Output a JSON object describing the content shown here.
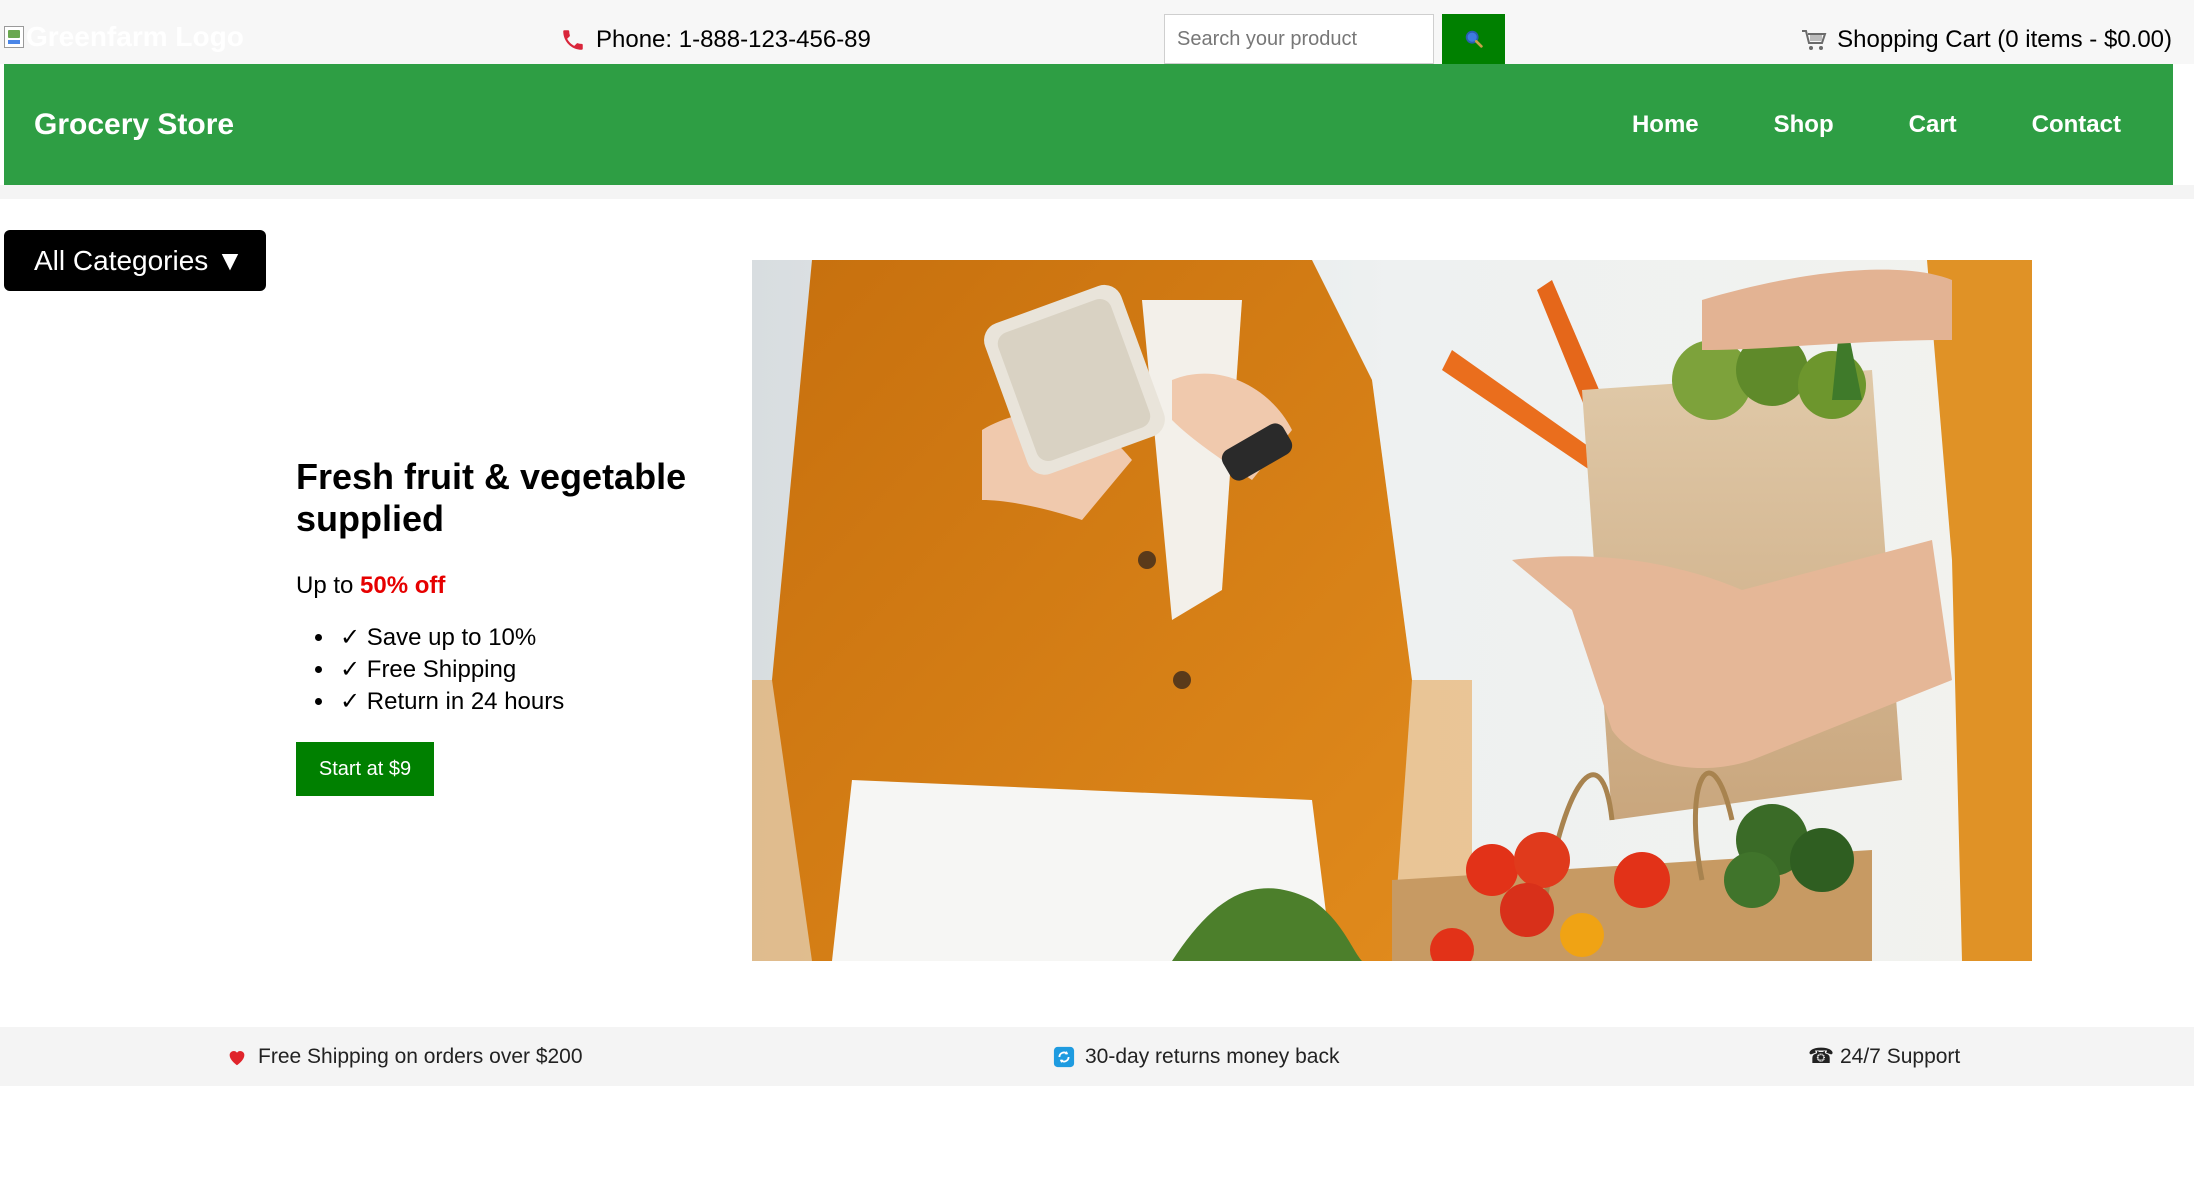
{
  "topbar": {
    "logo_alt": "Greenfarm Logo",
    "phone": "Phone: 1-888-123-456-89",
    "search_placeholder": "Search your product",
    "cart": "Shopping Cart (0 items - $0.00)"
  },
  "nav": {
    "brand": "Grocery Store",
    "links": [
      "Home",
      "Shop",
      "Cart",
      "Contact"
    ]
  },
  "categories_label": "All Categories ▼",
  "hero": {
    "title": "Fresh fruit & vegetable supplied",
    "offer_prefix": "Up to ",
    "offer_highlight": "50% off",
    "bullets": [
      "✓ Save up to 10%",
      "✓ Free Shipping",
      "✓ Return in 24 hours"
    ],
    "cta": "Start at $9"
  },
  "features": [
    {
      "icon": "heart-icon",
      "text": "Free Shipping on orders over $200"
    },
    {
      "icon": "refresh-icon",
      "text": "30-day returns money back"
    },
    {
      "icon": "phone-icon",
      "text": "☎ 24/7 Support"
    }
  ],
  "colors": {
    "nav_green": "#2e9e44",
    "button_green": "#008000",
    "highlight_red": "#e60000"
  }
}
